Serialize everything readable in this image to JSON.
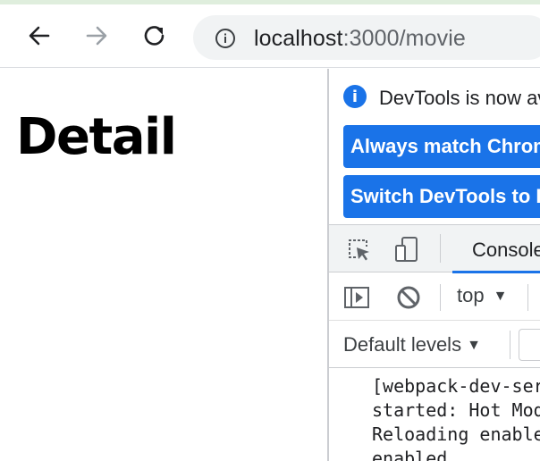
{
  "browser": {
    "url_host": "localhost",
    "url_rest": ":3000/movie",
    "icons": {
      "back": "arrow-left-icon",
      "forward": "arrow-right-icon",
      "reload": "reload-icon",
      "site_info": "info-icon"
    }
  },
  "page": {
    "heading": "Detail"
  },
  "devtools": {
    "infobar": {
      "icon_glyph": "i",
      "message": "DevTools is now available in your language!",
      "button_match": "Always match Chrome's language",
      "button_switch": "Switch DevTools to Korean"
    },
    "tabs": {
      "console_label": "Console"
    },
    "console_toolbar": {
      "context_label": "top",
      "levels_label": "Default levels",
      "caret": "▼"
    },
    "log_lines": "[webpack-dev-server] Hot Module Replacement\nstarted: Hot Module Replacement enabled, Live\nReloading enabled, Progress disabled, Overlay\nenabled."
  },
  "colors": {
    "accent": "#1a73e8",
    "toolbar_bg": "#f1f3f4"
  }
}
